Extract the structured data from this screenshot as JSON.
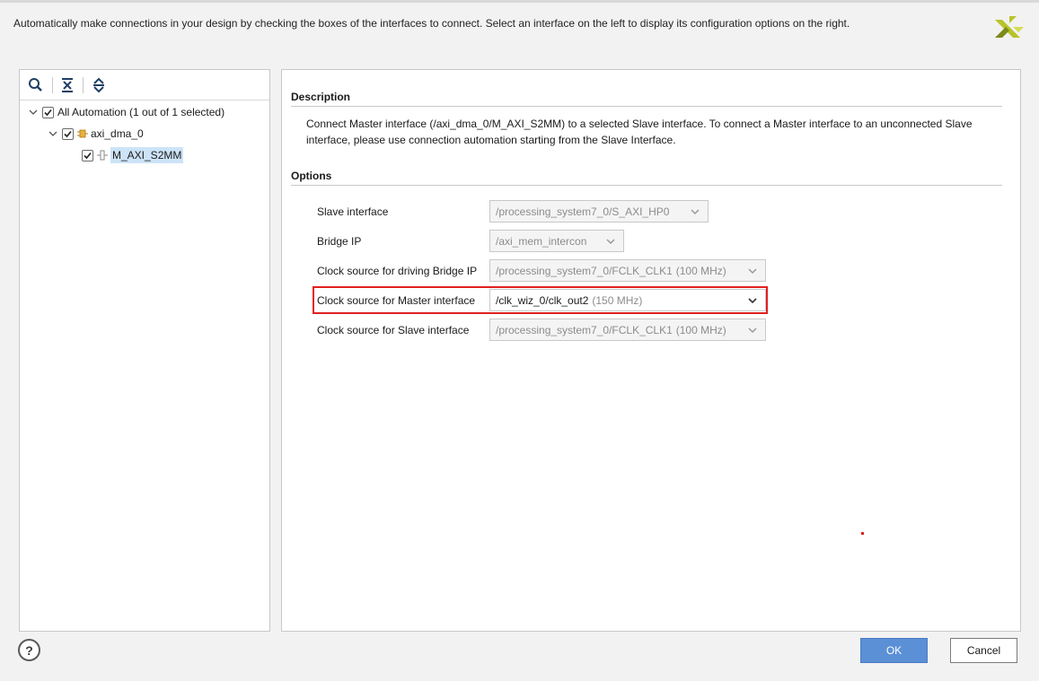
{
  "header": {
    "instruction": "Automatically make connections in your design by checking the boxes of the interfaces to connect. Select an interface on the left to display its configuration options on the right."
  },
  "logo": {
    "name": "xilinx-logo-icon"
  },
  "left_toolbar": {
    "icons": [
      "search-icon",
      "collapse-all-icon",
      "expand-all-icon"
    ]
  },
  "tree": {
    "root": {
      "label": "All Automation (1 out of 1 selected)",
      "checked": true,
      "expanded": true
    },
    "child": {
      "label": "axi_dma_0",
      "checked": true,
      "expanded": true,
      "icon": "ip-core-icon"
    },
    "leaf": {
      "label": "M_AXI_S2MM",
      "checked": true,
      "selected": true,
      "icon": "interface-port-icon"
    }
  },
  "description": {
    "title": "Description",
    "text": "Connect Master interface (/axi_dma_0/M_AXI_S2MM) to a selected Slave interface. To connect a Master interface to an unconnected Slave interface, please use connection automation starting from the Slave Interface."
  },
  "options": {
    "title": "Options",
    "rows": [
      {
        "label": "Slave interface",
        "value": "/processing_system7_0/S_AXI_HP0",
        "freq": "",
        "enabled": false
      },
      {
        "label": "Bridge IP",
        "value": "/axi_mem_intercon",
        "freq": "",
        "enabled": false
      },
      {
        "label": "Clock source for driving Bridge IP",
        "value": "/processing_system7_0/FCLK_CLK1",
        "freq": "(100 MHz)",
        "enabled": false
      },
      {
        "label": "Clock source for Master interface",
        "value": "/clk_wiz_0/clk_out2",
        "freq": "(150 MHz)",
        "enabled": true
      },
      {
        "label": "Clock source for Slave interface",
        "value": "/processing_system7_0/FCLK_CLK1",
        "freq": "(100 MHz)",
        "enabled": false
      }
    ]
  },
  "footer": {
    "help": "?",
    "ok": "OK",
    "cancel": "Cancel"
  },
  "colors": {
    "highlight": "#e02020",
    "ok_button": "#5b8fd6",
    "selection": "#cde3f7"
  }
}
